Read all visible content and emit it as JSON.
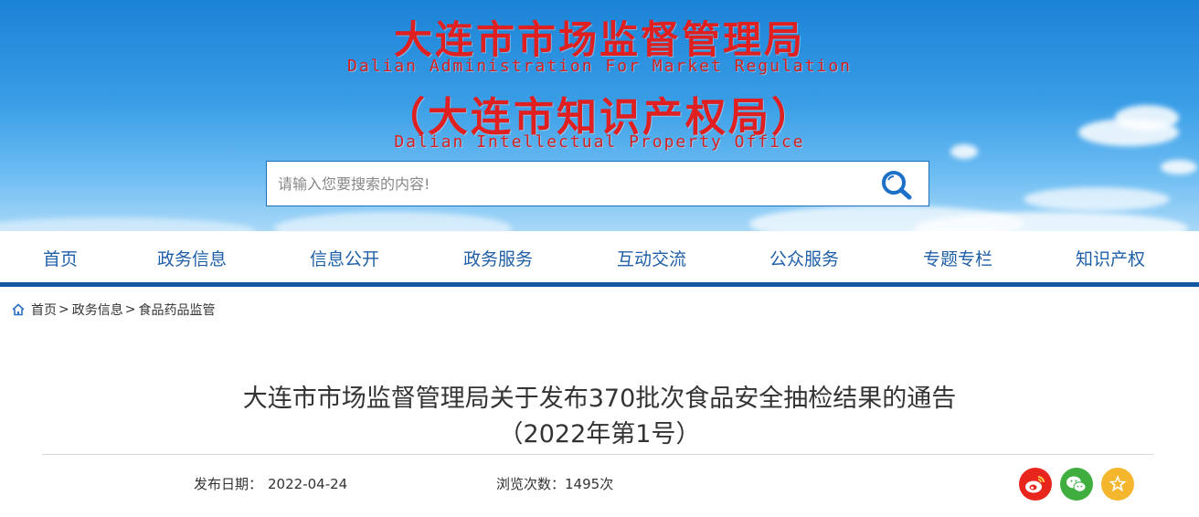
{
  "header": {
    "title_cn": "大连市市场监督管理局",
    "title_en": "Dalian Administration For Market Regulation",
    "subtitle_cn": "（大连市知识产权局）",
    "subtitle_en": "Dalian Intellectual Property Office"
  },
  "search": {
    "placeholder": "请输入您要搜索的内容!",
    "value": "",
    "button_icon": "search-icon"
  },
  "nav": {
    "items": [
      {
        "label": "首页"
      },
      {
        "label": "政务信息"
      },
      {
        "label": "信息公开"
      },
      {
        "label": "政务服务"
      },
      {
        "label": "互动交流"
      },
      {
        "label": "公众服务"
      },
      {
        "label": "专题专栏"
      },
      {
        "label": "知识产权"
      }
    ]
  },
  "breadcrumb": {
    "icon": "home-icon",
    "items": [
      {
        "label": "首页"
      },
      {
        "label": "政务信息"
      },
      {
        "label": "食品药品监管"
      }
    ],
    "separator": ">"
  },
  "article": {
    "title_line1": "大连市市场监督管理局关于发布370批次食品安全抽检结果的通告",
    "title_line2": "（2022年第1号）",
    "publish_label": "发布日期：",
    "publish_date": "2022-04-24",
    "views_label": "浏览次数：",
    "views_value": "1495次"
  },
  "share": [
    {
      "icon": "weibo-icon",
      "color": "#e8261d"
    },
    {
      "icon": "wechat-icon",
      "color": "#3fae3f"
    },
    {
      "icon": "favorite-star-icon",
      "color": "#f3b62c"
    }
  ],
  "colors": {
    "title_red": "#e02020",
    "nav_text": "#1f5fa8",
    "nav_bar": "#1456a0"
  }
}
